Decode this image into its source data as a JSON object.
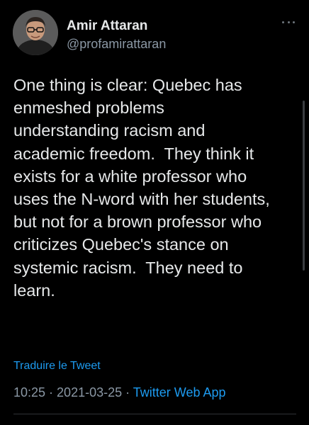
{
  "author": {
    "name": "Amir Attaran",
    "handle": "@profamirattaran"
  },
  "tweet": {
    "text": "One thing is clear: Quebec has\nenmeshed problems\nunderstanding racism and\nacademic freedom.  They think it\nexists for a white professor who\nuses the N-word with her students,\nbut not for a brown professor who\ncriticizes Quebec's stance on\nsystemic racism.  They need to\nlearn.",
    "translate_label": "Traduire le Tweet",
    "time": "10:25",
    "separator": " · ",
    "date": "2021-03-25",
    "app": "Twitter Web App"
  },
  "icons": {
    "more": "more-horizontal-icon"
  },
  "colors": {
    "background": "#000000",
    "text": "#e7e9ea",
    "secondary": "#8b98a5",
    "accent": "#1d9bf0"
  }
}
